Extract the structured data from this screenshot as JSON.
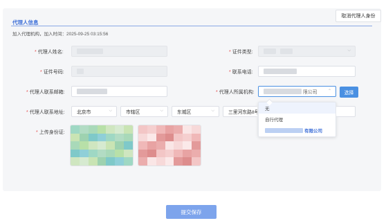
{
  "header": {
    "section_title": "代理人信息",
    "cancel_button": "取消代理人身份",
    "add_info": "加入代理机构，加入时间：2025-09-25 03:15:56"
  },
  "form": {
    "name_label": "代理人姓名:",
    "id_type_label": "证件类型:",
    "id_number_label": "证件号码:",
    "phone_label": "联系电话:",
    "email_label": "代理人联系邮箱:",
    "org_label": "代理人所属机构:",
    "org_value_suffix": "限公司",
    "select_button": "选择",
    "address_label": "代理人联系地址:",
    "province": "北京市",
    "district": "市辖区",
    "county": "东城区",
    "street": "三里河东路8号",
    "id_upload_label": "上传身份证:"
  },
  "dropdown": {
    "options": [
      "无",
      "自行代理"
    ],
    "selected_suffix": "有限公司"
  },
  "footer": {
    "submit_button": "提交保存"
  },
  "colors": {
    "accent": "#4a90e2",
    "title_blue": "#3d6fd8",
    "required": "#e34d4d",
    "submit_bg": "#7da4ec"
  }
}
